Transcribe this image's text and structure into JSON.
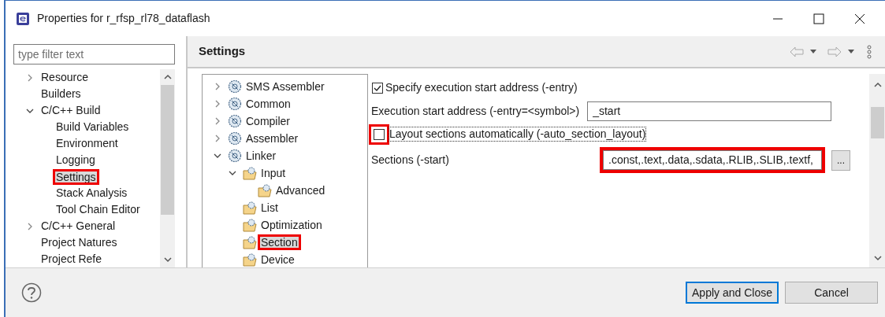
{
  "window": {
    "title": "Properties for r_rfsp_rl78_dataflash"
  },
  "filter": {
    "placeholder": "type filter text"
  },
  "nav_tree": [
    {
      "label": "Resource",
      "kind": "branch",
      "expanded": false,
      "selected": false,
      "highlighted": false
    },
    {
      "label": "Builders",
      "kind": "leaf",
      "selected": false,
      "highlighted": false
    },
    {
      "label": "C/C++ Build",
      "kind": "branch",
      "expanded": true,
      "selected": false,
      "highlighted": false,
      "children": [
        {
          "label": "Build Variables",
          "kind": "leaf",
          "selected": false,
          "highlighted": false
        },
        {
          "label": "Environment",
          "kind": "leaf",
          "selected": false,
          "highlighted": false
        },
        {
          "label": "Logging",
          "kind": "leaf",
          "selected": false,
          "highlighted": false
        },
        {
          "label": "Settings",
          "kind": "leaf",
          "selected": true,
          "highlighted": true
        },
        {
          "label": "Stack Analysis",
          "kind": "leaf",
          "selected": false,
          "highlighted": false
        },
        {
          "label": "Tool Chain Editor",
          "kind": "leaf",
          "selected": false,
          "highlighted": false
        }
      ]
    },
    {
      "label": "C/C++ General",
      "kind": "branch",
      "expanded": false,
      "selected": false,
      "highlighted": false
    },
    {
      "label": "Project Natures",
      "kind": "leaf",
      "selected": false,
      "highlighted": false
    },
    {
      "label": "Project Refe",
      "kind": "leaf",
      "selected": false,
      "highlighted": false
    }
  ],
  "page_title": "Settings",
  "tool_tree": [
    {
      "label": "SMS Assembler",
      "kind": "branch",
      "expanded": false,
      "selected": false,
      "highlighted": false
    },
    {
      "label": "Common",
      "kind": "branch",
      "expanded": false,
      "selected": false,
      "highlighted": false
    },
    {
      "label": "Compiler",
      "kind": "branch",
      "expanded": false,
      "selected": false,
      "highlighted": false
    },
    {
      "label": "Assembler",
      "kind": "branch",
      "expanded": false,
      "selected": false,
      "highlighted": false
    },
    {
      "label": "Linker",
      "kind": "branch",
      "expanded": true,
      "selected": false,
      "highlighted": false,
      "children": [
        {
          "label": "Input",
          "kind": "branch",
          "expanded": true,
          "selected": false,
          "highlighted": false,
          "children": [
            {
              "label": "Advanced",
              "kind": "leaf",
              "selected": false,
              "highlighted": false
            }
          ]
        },
        {
          "label": "List",
          "kind": "leaf",
          "selected": false,
          "highlighted": false
        },
        {
          "label": "Optimization",
          "kind": "leaf",
          "selected": false,
          "highlighted": false
        },
        {
          "label": "Section",
          "kind": "leaf",
          "selected": true,
          "highlighted": true
        },
        {
          "label": "Device",
          "kind": "leaf",
          "selected": false,
          "highlighted": false
        }
      ]
    }
  ],
  "options": [
    {
      "kind": "checkbox",
      "label": "Specify execution start address (-entry)",
      "checked": true,
      "highlighted": false
    },
    {
      "kind": "text",
      "label": "Execution start address (-entry=<symbol>)",
      "value": "_start",
      "highlighted": false
    },
    {
      "kind": "checkbox",
      "label": "Layout sections automatically (-auto_section_layout)",
      "checked": false,
      "highlighted": true
    },
    {
      "kind": "list",
      "label": "Sections (-start)",
      "value": ".const,.text,.data,.sdata,.RLIB,.SLIB,.textf,",
      "button": "...",
      "highlighted": true
    }
  ],
  "buttons": [
    {
      "label": "Apply and Close",
      "default": true
    },
    {
      "label": "Cancel",
      "default": false
    }
  ]
}
